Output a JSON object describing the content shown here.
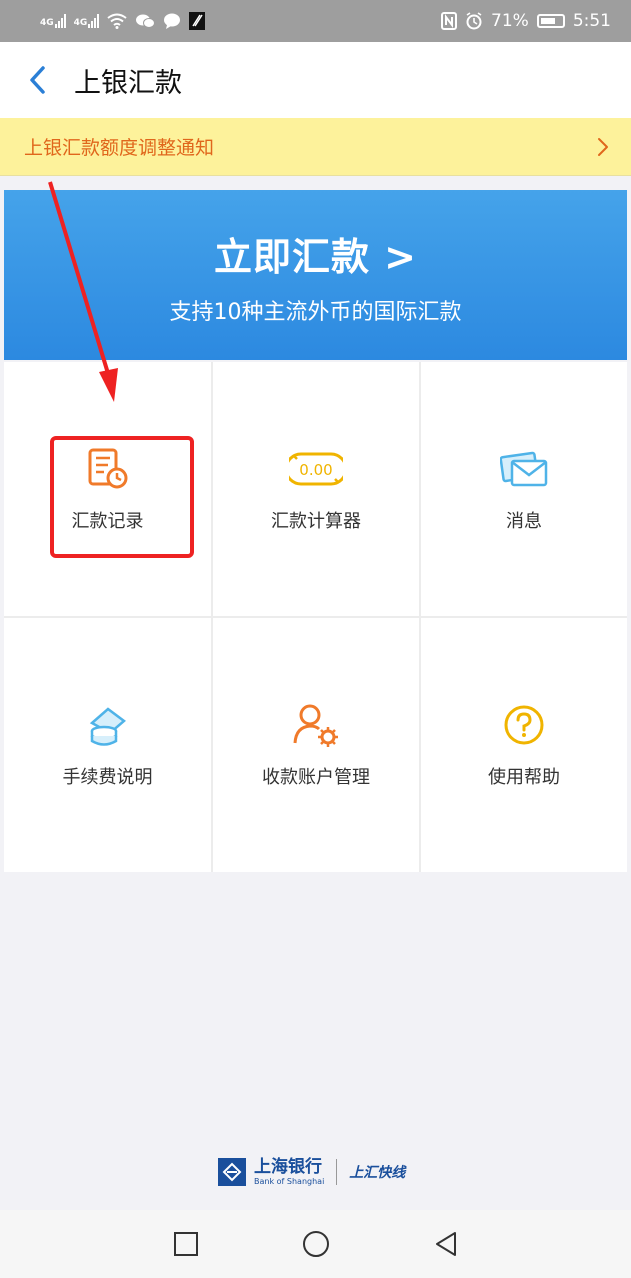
{
  "status_bar": {
    "signal1_label": "4G",
    "signal2_label": "4G",
    "battery_percent": "71%",
    "time": "5:51"
  },
  "header": {
    "title": "上银汇款"
  },
  "notice": {
    "text": "上银汇款额度调整通知"
  },
  "banner": {
    "title": "立即汇款 >",
    "subtitle": "支持10种主流外币的国际汇款"
  },
  "grid": {
    "items": [
      {
        "label": "汇款记录",
        "icon": "remittance-record-icon"
      },
      {
        "label": "汇款计算器",
        "icon": "calculator-icon"
      },
      {
        "label": "消息",
        "icon": "message-icon"
      },
      {
        "label": "手续费说明",
        "icon": "fee-description-icon"
      },
      {
        "label": "收款账户管理",
        "icon": "payee-account-icon"
      },
      {
        "label": "使用帮助",
        "icon": "help-icon"
      }
    ],
    "calculator_display": "0.00"
  },
  "footer": {
    "bank_name_cn": "上海银行",
    "bank_name_en": "Bank of Shanghai",
    "brand": "上汇快线"
  },
  "colors": {
    "accent_blue": "#2c89e0",
    "notice_orange": "#e0671c",
    "icon_orange": "#f07a2a",
    "icon_yellow": "#f0b400",
    "icon_light_blue": "#4fb3e8",
    "highlight_red": "#ee2222"
  }
}
